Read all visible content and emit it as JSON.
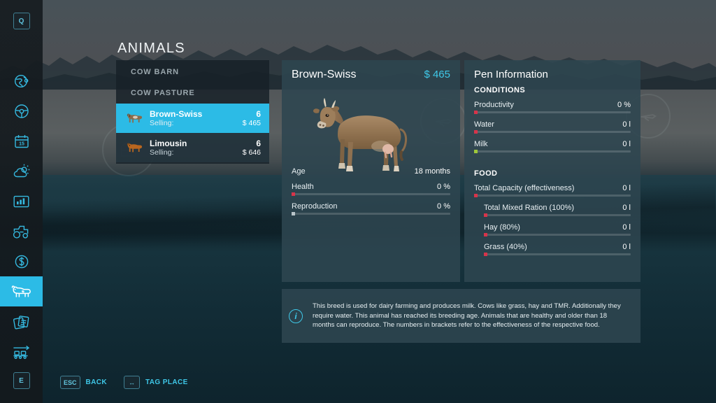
{
  "sidebar": {
    "top_key": "Q",
    "bottom_key": "E",
    "items": [
      {
        "icon": "globe-map-icon",
        "name": "sidebar-item-map",
        "active": false
      },
      {
        "icon": "steering-wheel-icon",
        "name": "sidebar-item-vehicles",
        "active": false
      },
      {
        "icon": "calendar-icon",
        "name": "sidebar-item-calendar",
        "active": false,
        "label": "15"
      },
      {
        "icon": "weather-icon",
        "name": "sidebar-item-weather",
        "active": false
      },
      {
        "icon": "statistics-icon",
        "name": "sidebar-item-statistics",
        "active": false
      },
      {
        "icon": "tractor-icon",
        "name": "sidebar-item-machines",
        "active": false
      },
      {
        "icon": "dollar-icon",
        "name": "sidebar-item-finances",
        "active": false
      },
      {
        "icon": "cow-icon",
        "name": "sidebar-item-animals",
        "active": true
      },
      {
        "icon": "contracts-icon",
        "name": "sidebar-item-contracts",
        "active": false
      },
      {
        "icon": "production-icon",
        "name": "sidebar-item-production",
        "active": false
      }
    ]
  },
  "page": {
    "title": "ANIMALS"
  },
  "animal_list": {
    "headers": [
      "COW BARN",
      "COW PASTURE"
    ],
    "rows": [
      {
        "name": "Brown-Swiss",
        "count": "6",
        "sub_label": "Selling:",
        "price": "$ 465",
        "selected": true,
        "thumb_color": "#8a6a4a"
      },
      {
        "name": "Limousin",
        "count": "6",
        "sub_label": "Selling:",
        "price": "$ 646",
        "selected": false,
        "thumb_color": "#b8661f"
      }
    ]
  },
  "detail": {
    "title": "Brown-Swiss",
    "price": "$ 465",
    "stats": [
      {
        "label": "Age",
        "value": "18 months",
        "fill_pct": 0,
        "marker": "none"
      },
      {
        "label": "Health",
        "value": "0 %",
        "fill_pct": 0,
        "marker": "red"
      },
      {
        "label": "Reproduction",
        "value": "0 %",
        "fill_pct": 0,
        "marker": "grey"
      }
    ]
  },
  "pen": {
    "title": "Pen Information",
    "conditions_label": "CONDITIONS",
    "conditions": [
      {
        "label": "Productivity",
        "value": "0 %",
        "fill_pct": 0,
        "marker": "red",
        "indent": false
      },
      {
        "label": "Water",
        "value": "0 l",
        "fill_pct": 0,
        "marker": "red",
        "indent": false
      },
      {
        "label": "Milk",
        "value": "0 l",
        "fill_pct": 0,
        "marker": "green",
        "indent": false
      }
    ],
    "food_label": "FOOD",
    "food": [
      {
        "label": "Total Capacity (effectiveness)",
        "value": "0 l",
        "fill_pct": 0,
        "marker": "red",
        "indent": false
      },
      {
        "label": "Total Mixed Ration (100%)",
        "value": "0 l",
        "fill_pct": 0,
        "marker": "red",
        "indent": true
      },
      {
        "label": "Hay (80%)",
        "value": "0 l",
        "fill_pct": 0,
        "marker": "red",
        "indent": true
      },
      {
        "label": "Grass (40%)",
        "value": "0 l",
        "fill_pct": 0,
        "marker": "red",
        "indent": true
      }
    ]
  },
  "info": {
    "icon": "info-icon",
    "text": "This breed is used for dairy farming and produces milk. Cows like grass, hay and TMR. Additionally they require water. This animal has reached its breeding age. Animals that are healthy and older than 18 months can reproduce. The numbers in brackets refer to the effectiveness of the respective food."
  },
  "footer": {
    "hints": [
      {
        "key": "ESC",
        "label": "BACK"
      },
      {
        "key": "↔",
        "label": "TAG PLACE"
      }
    ]
  },
  "colors": {
    "accent_cyan": "#2cbbe6",
    "price_cyan": "#3fc8e8",
    "panel_bg": "#2d4650",
    "marker_red": "#d8344a",
    "marker_green": "#9ec73a"
  }
}
